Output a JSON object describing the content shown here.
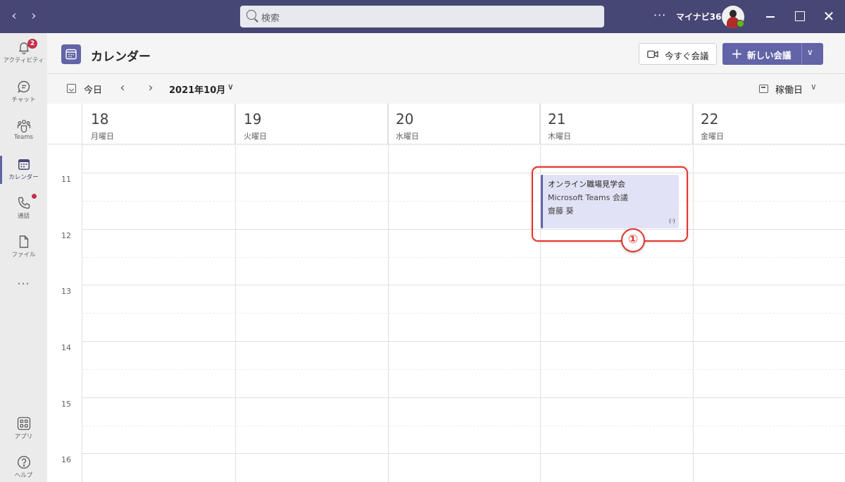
{
  "titlebar": {
    "search_placeholder": "検索",
    "more": "···",
    "org_name": "マイナビ365"
  },
  "rail": {
    "items": [
      {
        "label": "アクティビティ",
        "icon": "bell-icon",
        "badge": "2"
      },
      {
        "label": "チャット",
        "icon": "chat-icon"
      },
      {
        "label": "Teams",
        "icon": "teams-icon"
      },
      {
        "label": "カレンダー",
        "icon": "calendar-icon",
        "active": true
      },
      {
        "label": "通話",
        "icon": "phone-icon",
        "dot": true
      },
      {
        "label": "ファイル",
        "icon": "file-icon"
      }
    ],
    "more": "···",
    "bottom": [
      {
        "label": "アプリ",
        "icon": "apps-icon"
      },
      {
        "label": "ヘルプ",
        "icon": "help-icon"
      }
    ]
  },
  "header": {
    "title": "カレンダー",
    "meet_now": "今すぐ会議",
    "new_meeting": "新しい会議"
  },
  "toolbar": {
    "today": "今日",
    "month": "2021年10月",
    "view": "稼働日"
  },
  "days": [
    {
      "num": "18",
      "name": "月曜日"
    },
    {
      "num": "19",
      "name": "火曜日"
    },
    {
      "num": "20",
      "name": "水曜日"
    },
    {
      "num": "21",
      "name": "木曜日"
    },
    {
      "num": "22",
      "name": "金曜日"
    }
  ],
  "hours": [
    "11",
    "12",
    "13",
    "14",
    "15",
    "16"
  ],
  "event": {
    "title": "オンライン職場見学会",
    "subtitle": "Microsoft Teams 会議",
    "organizer": "齋藤 葵",
    "live_icon": "(·)"
  },
  "annotation": {
    "number": "①"
  },
  "colors": {
    "titlebar": "#464775",
    "accent": "#6264a7",
    "event_bg": "#e2e2f6",
    "annotation": "#e0362b",
    "badge": "#c4314b"
  }
}
